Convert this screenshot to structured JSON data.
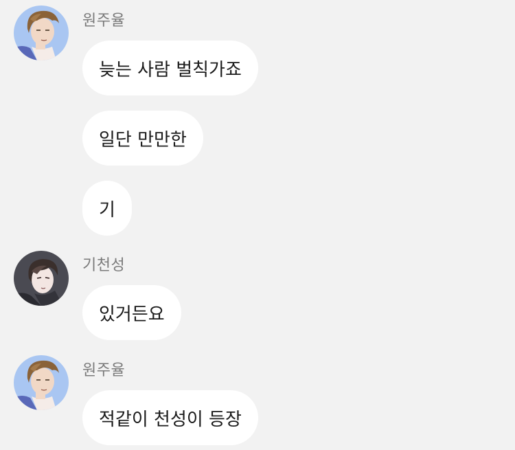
{
  "chat": {
    "groups": [
      {
        "sender": "원주율",
        "avatar_icon": "brown-hair-man-avatar-icon",
        "messages": [
          "늦는 사람 벌칙가죠",
          "일단 만만한",
          "기"
        ]
      },
      {
        "sender": "기천성",
        "avatar_icon": "dark-hair-man-avatar-icon",
        "messages": [
          "있거든요"
        ]
      },
      {
        "sender": "원주율",
        "avatar_icon": "brown-hair-man-avatar-icon",
        "messages": [
          "적같이 천성이 등장"
        ]
      }
    ]
  },
  "colors": {
    "background": "#f2f2f2",
    "bubble": "#ffffff",
    "sender_text": "#7a7a7a",
    "message_text": "#1a1a1a",
    "avatar1_bg": "#a9c6f2",
    "avatar2_bg": "#4a4a52"
  }
}
